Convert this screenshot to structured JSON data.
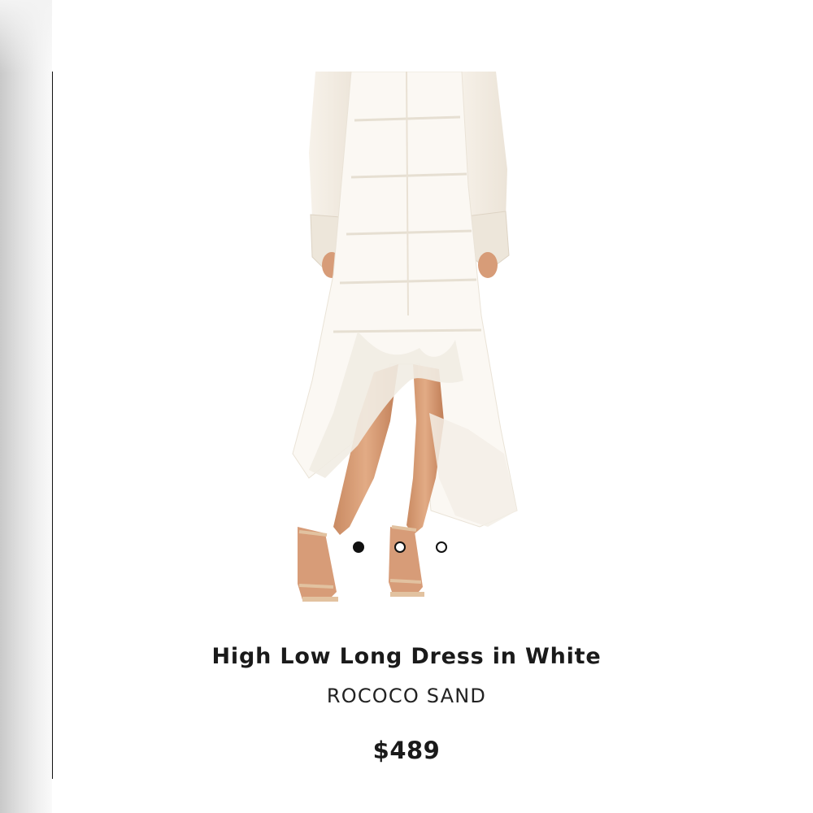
{
  "product": {
    "title": "High Low Long Dress in White",
    "brand": "ROCOCO SAND",
    "price": "$489"
  },
  "image": {
    "subject": "dress-photo",
    "colors": {
      "dress": "#fbf8f3",
      "lace": "#f1ece3",
      "skin": "#d9a27c",
      "sandal": "#e2c2a0"
    }
  },
  "carousel": {
    "total": 3,
    "active_index": 0
  }
}
